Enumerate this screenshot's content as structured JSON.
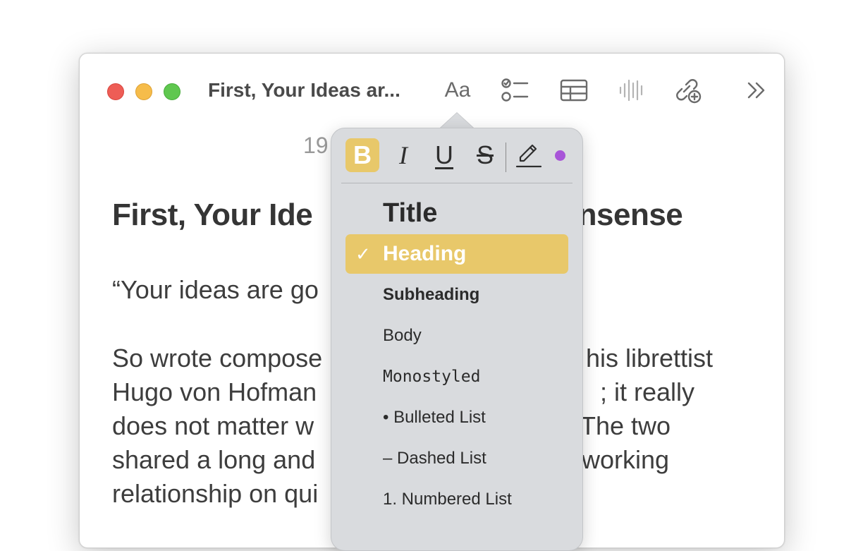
{
  "window": {
    "title": "First, Your Ideas ar...",
    "traffic_lights": {
      "close": "#ee5d56",
      "minimize": "#f6bc4a",
      "zoom": "#5fc74f"
    }
  },
  "toolbar": {
    "format_label": "Aa",
    "icons": [
      "checklist-icon",
      "table-icon",
      "audio-waveform-icon",
      "collaborate-link-icon",
      "more-chevrons-icon"
    ]
  },
  "note": {
    "date_partial": "19",
    "title_left": "First, Your Ide",
    "title_right": "onsense",
    "quote_left": "“Your ideas are go",
    "body_left": [
      "So wrote compose",
      "Hugo von Hofman",
      "does not matter w",
      "shared a long and",
      "relationship on qui"
    ],
    "body_right": [
      "his librettist",
      "; it really",
      "The two",
      "working",
      ""
    ]
  },
  "format_popover": {
    "bold_label": "B",
    "italic_label": "I",
    "underline_label": "U",
    "strike_label": "S",
    "color_dot": "#a855d8",
    "accent": "#e8c86a",
    "styles": {
      "title": "Title",
      "heading": "Heading",
      "subheading": "Subheading",
      "body": "Body",
      "monostyled": "Monostyled",
      "bulleted": "• Bulleted List",
      "dashed": "– Dashed List",
      "numbered": "1. Numbered List"
    },
    "selected_style": "Heading",
    "check_mark": "✓"
  }
}
